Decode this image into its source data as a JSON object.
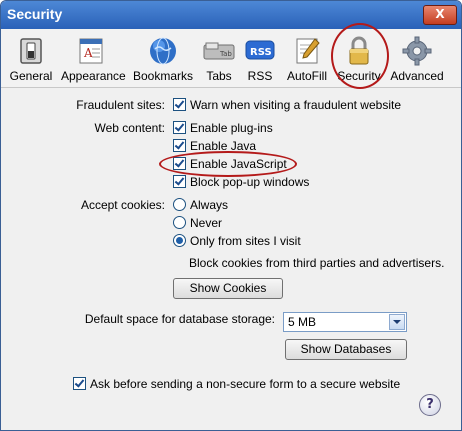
{
  "window": {
    "title": "Security",
    "close_label": "X"
  },
  "toolbar": {
    "items": [
      {
        "label": "General",
        "icon": "general-switch-icon"
      },
      {
        "label": "Appearance",
        "icon": "appearance-icon"
      },
      {
        "label": "Bookmarks",
        "icon": "globe-icon"
      },
      {
        "label": "Tabs",
        "icon": "tabs-icon"
      },
      {
        "label": "RSS",
        "icon": "rss-icon",
        "icon_text": "RSS"
      },
      {
        "label": "AutoFill",
        "icon": "autofill-icon"
      },
      {
        "label": "Security",
        "icon": "lock-icon",
        "selected": true
      },
      {
        "label": "Advanced",
        "icon": "gear-icon"
      }
    ],
    "tabs_icon_text": "Tab"
  },
  "fraudulent": {
    "label": "Fraudulent sites:",
    "option": "Warn when visiting a fraudulent website",
    "checked": true
  },
  "web_content": {
    "label": "Web content:",
    "options": [
      {
        "label": "Enable plug-ins",
        "checked": true
      },
      {
        "label": "Enable Java",
        "checked": true
      },
      {
        "label": "Enable JavaScript",
        "checked": true
      },
      {
        "label": "Block pop-up windows",
        "checked": true
      }
    ]
  },
  "cookies": {
    "label": "Accept cookies:",
    "options": [
      {
        "label": "Always",
        "selected": false
      },
      {
        "label": "Never",
        "selected": false
      },
      {
        "label": "Only from sites I visit",
        "selected": true
      }
    ],
    "note": "Block cookies from third parties and advertisers.",
    "show_button": "Show Cookies"
  },
  "database": {
    "label": "Default space for database storage:",
    "value": "5 MB",
    "show_button": "Show Databases"
  },
  "nonsecure": {
    "label": "Ask before sending a non-secure form to a secure website",
    "checked": true
  },
  "help_label": "?",
  "colors": {
    "title_bar": "#2a61b8",
    "highlight_ring": "#b41a1a",
    "check": "#1a4b8c"
  }
}
